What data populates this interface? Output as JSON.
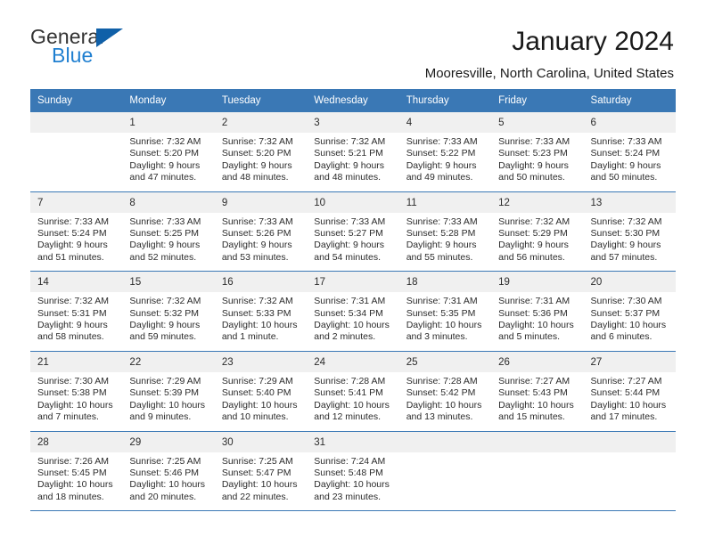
{
  "brand": {
    "name_part1": "General",
    "name_part2": "Blue",
    "color_dark": "#333333",
    "color_blue": "#1f7fd0",
    "triangle_color": "#1060a8"
  },
  "header": {
    "title": "January 2024",
    "subtitle": "Mooresville, North Carolina, United States"
  },
  "theme": {
    "header_row_bg": "#3a78b5",
    "header_row_text": "#ffffff",
    "daynum_bg": "#f0f0f0",
    "grid_line": "#3a78b5",
    "body_text": "#2b2b2b"
  },
  "weekdays": [
    "Sunday",
    "Monday",
    "Tuesday",
    "Wednesday",
    "Thursday",
    "Friday",
    "Saturday"
  ],
  "weeks": [
    {
      "days": [
        {
          "num": "",
          "lines": []
        },
        {
          "num": "1",
          "lines": [
            "Sunrise: 7:32 AM",
            "Sunset: 5:20 PM",
            "Daylight: 9 hours",
            "and 47 minutes."
          ]
        },
        {
          "num": "2",
          "lines": [
            "Sunrise: 7:32 AM",
            "Sunset: 5:20 PM",
            "Daylight: 9 hours",
            "and 48 minutes."
          ]
        },
        {
          "num": "3",
          "lines": [
            "Sunrise: 7:32 AM",
            "Sunset: 5:21 PM",
            "Daylight: 9 hours",
            "and 48 minutes."
          ]
        },
        {
          "num": "4",
          "lines": [
            "Sunrise: 7:33 AM",
            "Sunset: 5:22 PM",
            "Daylight: 9 hours",
            "and 49 minutes."
          ]
        },
        {
          "num": "5",
          "lines": [
            "Sunrise: 7:33 AM",
            "Sunset: 5:23 PM",
            "Daylight: 9 hours",
            "and 50 minutes."
          ]
        },
        {
          "num": "6",
          "lines": [
            "Sunrise: 7:33 AM",
            "Sunset: 5:24 PM",
            "Daylight: 9 hours",
            "and 50 minutes."
          ]
        }
      ]
    },
    {
      "days": [
        {
          "num": "7",
          "lines": [
            "Sunrise: 7:33 AM",
            "Sunset: 5:24 PM",
            "Daylight: 9 hours",
            "and 51 minutes."
          ]
        },
        {
          "num": "8",
          "lines": [
            "Sunrise: 7:33 AM",
            "Sunset: 5:25 PM",
            "Daylight: 9 hours",
            "and 52 minutes."
          ]
        },
        {
          "num": "9",
          "lines": [
            "Sunrise: 7:33 AM",
            "Sunset: 5:26 PM",
            "Daylight: 9 hours",
            "and 53 minutes."
          ]
        },
        {
          "num": "10",
          "lines": [
            "Sunrise: 7:33 AM",
            "Sunset: 5:27 PM",
            "Daylight: 9 hours",
            "and 54 minutes."
          ]
        },
        {
          "num": "11",
          "lines": [
            "Sunrise: 7:33 AM",
            "Sunset: 5:28 PM",
            "Daylight: 9 hours",
            "and 55 minutes."
          ]
        },
        {
          "num": "12",
          "lines": [
            "Sunrise: 7:32 AM",
            "Sunset: 5:29 PM",
            "Daylight: 9 hours",
            "and 56 minutes."
          ]
        },
        {
          "num": "13",
          "lines": [
            "Sunrise: 7:32 AM",
            "Sunset: 5:30 PM",
            "Daylight: 9 hours",
            "and 57 minutes."
          ]
        }
      ]
    },
    {
      "days": [
        {
          "num": "14",
          "lines": [
            "Sunrise: 7:32 AM",
            "Sunset: 5:31 PM",
            "Daylight: 9 hours",
            "and 58 minutes."
          ]
        },
        {
          "num": "15",
          "lines": [
            "Sunrise: 7:32 AM",
            "Sunset: 5:32 PM",
            "Daylight: 9 hours",
            "and 59 minutes."
          ]
        },
        {
          "num": "16",
          "lines": [
            "Sunrise: 7:32 AM",
            "Sunset: 5:33 PM",
            "Daylight: 10 hours",
            "and 1 minute."
          ]
        },
        {
          "num": "17",
          "lines": [
            "Sunrise: 7:31 AM",
            "Sunset: 5:34 PM",
            "Daylight: 10 hours",
            "and 2 minutes."
          ]
        },
        {
          "num": "18",
          "lines": [
            "Sunrise: 7:31 AM",
            "Sunset: 5:35 PM",
            "Daylight: 10 hours",
            "and 3 minutes."
          ]
        },
        {
          "num": "19",
          "lines": [
            "Sunrise: 7:31 AM",
            "Sunset: 5:36 PM",
            "Daylight: 10 hours",
            "and 5 minutes."
          ]
        },
        {
          "num": "20",
          "lines": [
            "Sunrise: 7:30 AM",
            "Sunset: 5:37 PM",
            "Daylight: 10 hours",
            "and 6 minutes."
          ]
        }
      ]
    },
    {
      "days": [
        {
          "num": "21",
          "lines": [
            "Sunrise: 7:30 AM",
            "Sunset: 5:38 PM",
            "Daylight: 10 hours",
            "and 7 minutes."
          ]
        },
        {
          "num": "22",
          "lines": [
            "Sunrise: 7:29 AM",
            "Sunset: 5:39 PM",
            "Daylight: 10 hours",
            "and 9 minutes."
          ]
        },
        {
          "num": "23",
          "lines": [
            "Sunrise: 7:29 AM",
            "Sunset: 5:40 PM",
            "Daylight: 10 hours",
            "and 10 minutes."
          ]
        },
        {
          "num": "24",
          "lines": [
            "Sunrise: 7:28 AM",
            "Sunset: 5:41 PM",
            "Daylight: 10 hours",
            "and 12 minutes."
          ]
        },
        {
          "num": "25",
          "lines": [
            "Sunrise: 7:28 AM",
            "Sunset: 5:42 PM",
            "Daylight: 10 hours",
            "and 13 minutes."
          ]
        },
        {
          "num": "26",
          "lines": [
            "Sunrise: 7:27 AM",
            "Sunset: 5:43 PM",
            "Daylight: 10 hours",
            "and 15 minutes."
          ]
        },
        {
          "num": "27",
          "lines": [
            "Sunrise: 7:27 AM",
            "Sunset: 5:44 PM",
            "Daylight: 10 hours",
            "and 17 minutes."
          ]
        }
      ]
    },
    {
      "days": [
        {
          "num": "28",
          "lines": [
            "Sunrise: 7:26 AM",
            "Sunset: 5:45 PM",
            "Daylight: 10 hours",
            "and 18 minutes."
          ]
        },
        {
          "num": "29",
          "lines": [
            "Sunrise: 7:25 AM",
            "Sunset: 5:46 PM",
            "Daylight: 10 hours",
            "and 20 minutes."
          ]
        },
        {
          "num": "30",
          "lines": [
            "Sunrise: 7:25 AM",
            "Sunset: 5:47 PM",
            "Daylight: 10 hours",
            "and 22 minutes."
          ]
        },
        {
          "num": "31",
          "lines": [
            "Sunrise: 7:24 AM",
            "Sunset: 5:48 PM",
            "Daylight: 10 hours",
            "and 23 minutes."
          ]
        },
        {
          "num": "",
          "lines": []
        },
        {
          "num": "",
          "lines": []
        },
        {
          "num": "",
          "lines": []
        }
      ]
    }
  ]
}
